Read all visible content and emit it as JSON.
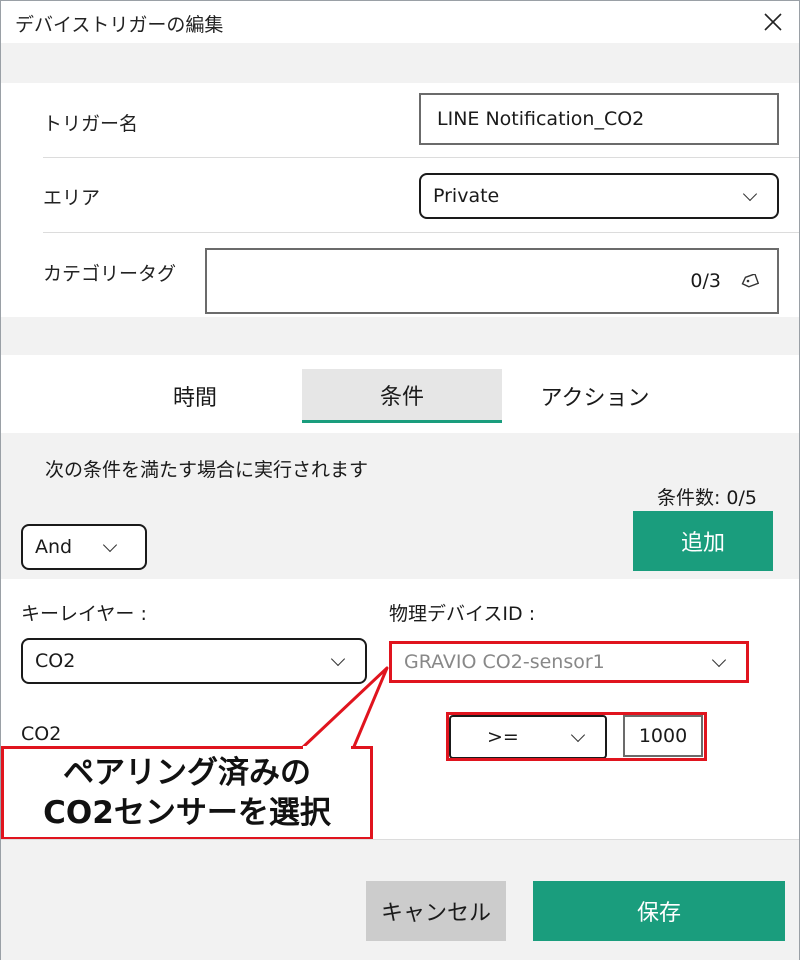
{
  "window": {
    "title": "デバイストリガーの編集"
  },
  "form": {
    "trigger_name_label": "トリガー名",
    "trigger_name_value": "LINE Notification_CO2",
    "area_label": "エリア",
    "area_value": "Private",
    "category_tag_label": "カテゴリータグ",
    "category_tag_count": "0/3"
  },
  "tabs": [
    {
      "label": "時間",
      "active": false
    },
    {
      "label": "条件",
      "active": true
    },
    {
      "label": "アクション",
      "active": false
    }
  ],
  "conditions": {
    "description": "次の条件を満たす場合に実行されます",
    "count_label": "条件数: 0/5",
    "logic_value": "And",
    "add_button": "追加",
    "key_layer_label": "キーレイヤー :",
    "key_layer_value": "CO2",
    "device_id_label": "物理デバイスID :",
    "device_id_value": "GRAVIO CO2-sensor1",
    "sensor_label": "CO2",
    "operator_value": ">=",
    "threshold_value": "1000"
  },
  "annotation": {
    "line1": "ペアリング済みの",
    "line2": "CO2センサーを選択",
    "color": "#e0141e"
  },
  "footer": {
    "cancel_label": "キャンセル",
    "save_label": "保存"
  },
  "colors": {
    "accent": "#1a9d7d",
    "highlight": "#e0141e"
  }
}
